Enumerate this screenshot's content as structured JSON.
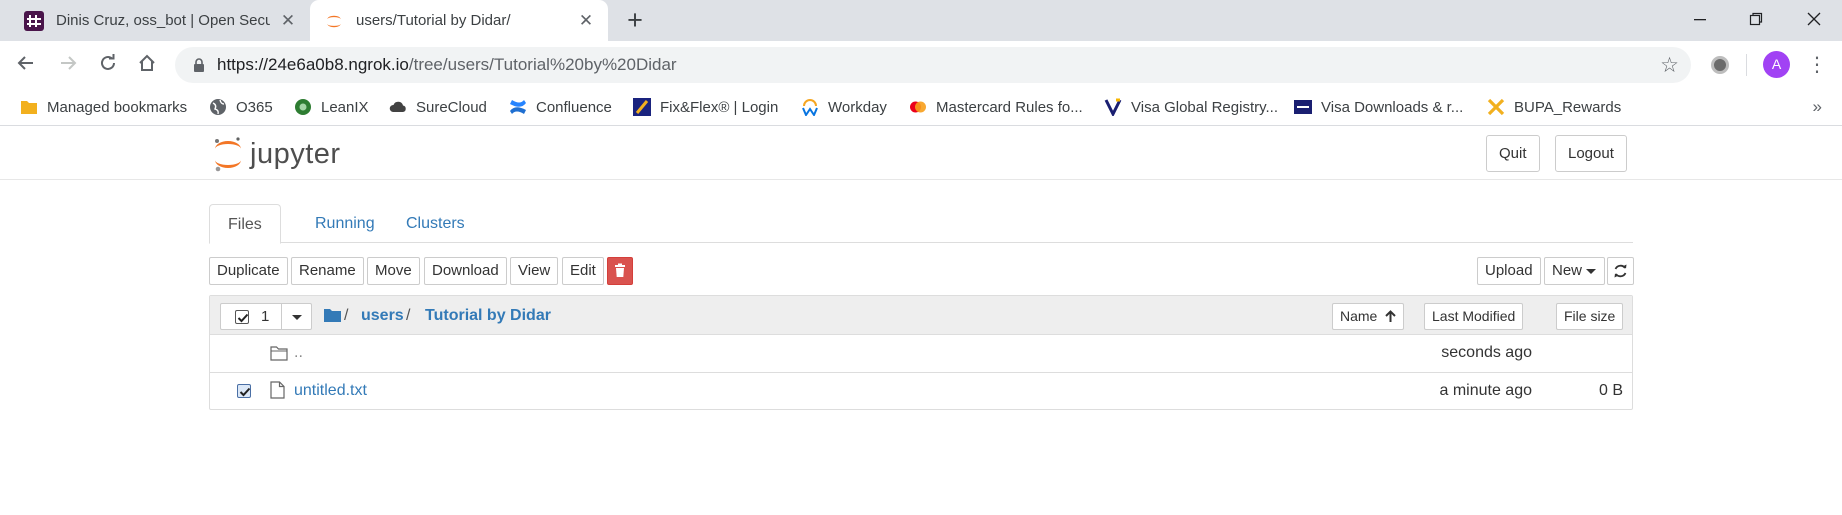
{
  "browser": {
    "tabs": [
      {
        "title": "Dinis Cruz, oss_bot | Open Securi",
        "icon": "slack-favicon",
        "active": false
      },
      {
        "title": "users/Tutorial by Didar/",
        "icon": "jupyter-favicon",
        "active": true
      }
    ],
    "new_tab": "+",
    "window_controls": {
      "minimize": "—",
      "restore": "❐",
      "close": "✕"
    },
    "address": {
      "host": "https://24e6a0b8.ngrok.io",
      "path": "/tree/users/Tutorial%20by%20Didar"
    },
    "profile_initial": "A"
  },
  "bookmarks": [
    {
      "label": "Managed bookmarks",
      "icon": "folder-icon",
      "color": "#f2b01e"
    },
    {
      "label": "O365",
      "icon": "globe-icon",
      "color": "#5f6368"
    },
    {
      "label": "LeanIX",
      "icon": "leanix-icon",
      "color": "#2e7d32"
    },
    {
      "label": "SureCloud",
      "icon": "cloud-icon",
      "color": "#424242"
    },
    {
      "label": "Confluence",
      "icon": "confluence-icon",
      "color": "#1f6fd1"
    },
    {
      "label": "Fix&Flex® | Login",
      "icon": "fixflex-icon",
      "color": "#1a237e"
    },
    {
      "label": "Workday",
      "icon": "workday-icon",
      "color": "#f5a623"
    },
    {
      "label": "Mastercard Rules fo...",
      "icon": "mastercard-icon",
      "color": "#eb001b"
    },
    {
      "label": "Visa Global Registry...",
      "icon": "visa-v-icon",
      "color": "#1a1f71"
    },
    {
      "label": "Visa Downloads & r...",
      "icon": "visa-card-icon",
      "color": "#1a1f71"
    },
    {
      "label": "BUPA_Rewards",
      "icon": "bupa-icon",
      "color": "#f2b01e"
    }
  ],
  "bookmarks_more": "»",
  "jupyter": {
    "logo_text": "jupyter",
    "quit_label": "Quit",
    "logout_label": "Logout",
    "tabs": [
      {
        "label": "Files",
        "active": true
      },
      {
        "label": "Running",
        "active": false
      },
      {
        "label": "Clusters",
        "active": false
      }
    ],
    "actions": [
      "Duplicate",
      "Rename",
      "Move",
      "Download",
      "View",
      "Edit"
    ],
    "upload_label": "Upload",
    "new_label": "New",
    "selected_count": "1",
    "breadcrumb": [
      "users",
      "Tutorial by Didar"
    ],
    "sort": {
      "name": "Name",
      "modified": "Last Modified",
      "size": "File size"
    },
    "rows": [
      {
        "name": "..",
        "type": "folder",
        "modified": "seconds ago",
        "size": "",
        "checked": false
      },
      {
        "name": "untitled.txt",
        "type": "file",
        "modified": "a minute ago",
        "size": "0 B",
        "checked": true
      }
    ],
    "accent": "#337ab7",
    "danger": "#d9534f",
    "logo_orange": "#f37626"
  }
}
